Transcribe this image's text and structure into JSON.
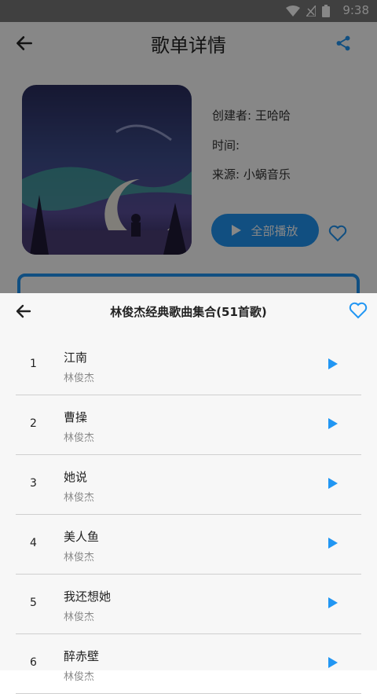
{
  "status": {
    "time": "9:38"
  },
  "detail": {
    "title": "歌单详情",
    "creator": "创建者: 王哈哈",
    "time": "时间:",
    "source": "来源: 小蜗音乐",
    "play_all": "全部播放"
  },
  "sheet": {
    "title": "林俊杰经典歌曲集合(51首歌)",
    "songs": [
      {
        "index": "1",
        "name": "江南",
        "artist": "林俊杰"
      },
      {
        "index": "2",
        "name": "曹操",
        "artist": "林俊杰"
      },
      {
        "index": "3",
        "name": "她说",
        "artist": "林俊杰"
      },
      {
        "index": "4",
        "name": "美人鱼",
        "artist": "林俊杰"
      },
      {
        "index": "5",
        "name": "我还想她",
        "artist": "林俊杰"
      },
      {
        "index": "6",
        "name": "醉赤壁",
        "artist": "林俊杰"
      }
    ]
  },
  "colors": {
    "accent": "#2196f3",
    "dim_overlay": "#00000078"
  },
  "icons": [
    "back-arrow-icon",
    "share-icon",
    "heart-icon",
    "play-icon",
    "wifi-icon",
    "sim-icon",
    "battery-icon"
  ]
}
